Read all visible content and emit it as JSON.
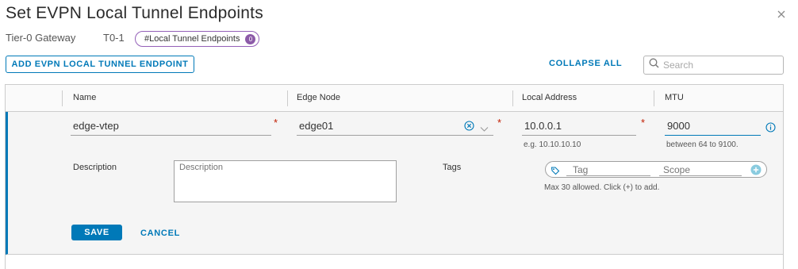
{
  "dialog": {
    "title": "Set EVPN Local Tunnel Endpoints",
    "close_icon": "close-icon"
  },
  "breadcrumb": {
    "gateway_label": "Tier-0 Gateway",
    "gateway_value": "T0-1",
    "pill_label": "#Local Tunnel Endpoints",
    "pill_count": "0"
  },
  "toolbar": {
    "add_label": "ADD EVPN LOCAL TUNNEL ENDPOINT",
    "collapse_label": "COLLAPSE ALL",
    "search_placeholder": "Search"
  },
  "table": {
    "columns": [
      "Name",
      "Edge Node",
      "Local Address",
      "MTU"
    ]
  },
  "edit_row": {
    "name_value": "edge-vtep",
    "edge_node_value": "edge01",
    "local_address_value": "10.0.0.1",
    "local_address_hint": "e.g. 10.10.10.10",
    "mtu_value": "9000",
    "mtu_hint": "between 64 to 9100.",
    "required_mark": "*",
    "description_label": "Description",
    "description_placeholder": "Description",
    "tags_label": "Tags",
    "tag_placeholder": "Tag",
    "scope_placeholder": "Scope",
    "tags_hint": "Max 30 allowed. Click (+) to add.",
    "save_label": "SAVE",
    "cancel_label": "CANCEL"
  },
  "colors": {
    "accent": "#0079b8",
    "required": "#c21d00",
    "pill_border": "#9460b8"
  }
}
